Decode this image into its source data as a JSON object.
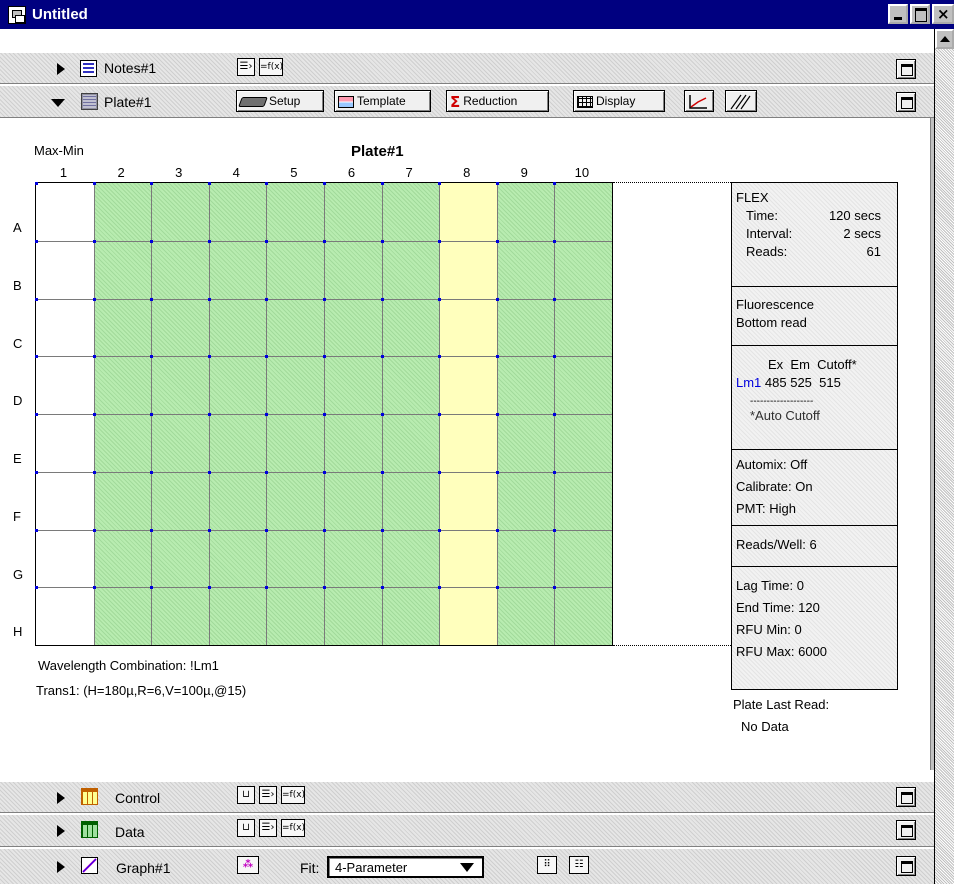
{
  "window": {
    "title": "Untitled"
  },
  "notes": {
    "label": "Notes#1",
    "formula_label": "=f(x)"
  },
  "plate_section": {
    "label": "Plate#1",
    "buttons": {
      "setup": "Setup",
      "template": "Template",
      "reduction": "Reduction",
      "display": "Display"
    }
  },
  "plate": {
    "title": "Plate#1",
    "mode": "Max-Min",
    "columns": [
      "1",
      "2",
      "3",
      "4",
      "5",
      "6",
      "7",
      "8",
      "9",
      "10"
    ],
    "rows": [
      "A",
      "B",
      "C",
      "D",
      "E",
      "F",
      "G",
      "H"
    ],
    "column_states": [
      "empty",
      "green",
      "green",
      "green",
      "green",
      "green",
      "green",
      "yellow",
      "green",
      "green"
    ],
    "colors": {
      "green": "#b8ecb0",
      "yellow": "#ffffbd",
      "dot": "#0000dd"
    },
    "wavelength_combination": "Wavelength Combination: !Lm1",
    "trans": "Trans1: (H=180µ,R=6,V=100µ,@15)"
  },
  "info": {
    "instrument": "FLEX",
    "time_key": "Time:",
    "time_val": "120 secs",
    "interval_key": "Interval:",
    "interval_val": "2 secs",
    "reads_key": "Reads:",
    "reads_val": "61",
    "mode1": "Fluorescence",
    "mode2": "Bottom read",
    "wl_header": "Ex  Em  Cutoff*",
    "wl_name": "Lm1",
    "wl_values": " 485 525  515",
    "dash_line": "-------------------",
    "auto_cutoff": "*Auto Cutoff",
    "automix": "Automix: Off",
    "calibrate": "Calibrate: On",
    "pmt": "PMT: High",
    "reads_well": "Reads/Well: 6",
    "lag_time": "Lag Time: 0",
    "end_time": "End Time: 120",
    "rfu_min": "RFU Min: 0",
    "rfu_max": "RFU Max: 6000"
  },
  "plate_last_read": {
    "label": "Plate Last Read:",
    "value": "No Data"
  },
  "control": {
    "label": "Control",
    "formula_label": "=f(x)"
  },
  "data_section": {
    "label": "Data",
    "formula_label": "=f(x)"
  },
  "graph": {
    "label": "Graph#1",
    "fit_label": "Fit:",
    "fit_value": "4-Parameter"
  }
}
